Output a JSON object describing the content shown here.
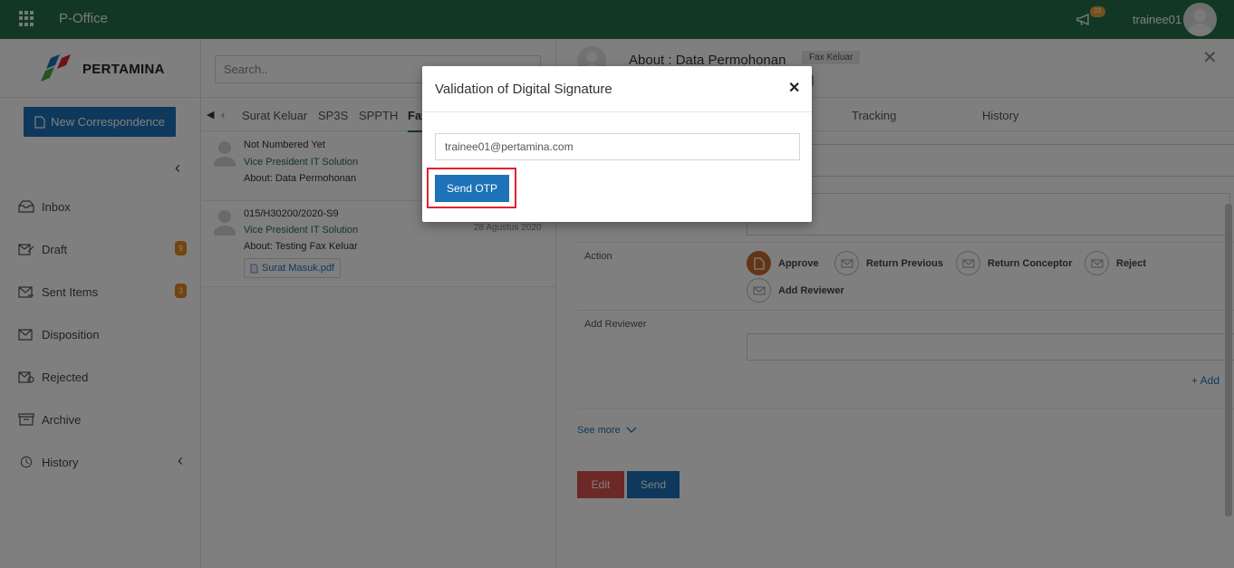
{
  "topbar": {
    "app_title": "P-Office",
    "notification_count": "23",
    "username": "trainee01"
  },
  "sidebar": {
    "logo_text": "PERTAMINA",
    "new_button": "New Correspondence",
    "items": [
      {
        "label": "Inbox",
        "icon": "inbox-icon",
        "badge": ""
      },
      {
        "label": "Draft",
        "icon": "draft-icon",
        "badge": "9"
      },
      {
        "label": "Sent Items",
        "icon": "sent-icon",
        "badge": "3"
      },
      {
        "label": "Disposition",
        "icon": "disposition-icon",
        "badge": ""
      },
      {
        "label": "Rejected",
        "icon": "rejected-icon",
        "badge": ""
      },
      {
        "label": "Archive",
        "icon": "archive-icon",
        "badge": ""
      },
      {
        "label": "History",
        "icon": "history-icon",
        "badge": ""
      }
    ]
  },
  "list": {
    "search_placeholder": "Search..",
    "tabs": [
      "Surat Keluar",
      "SP3S",
      "SPPTH",
      "Fax"
    ],
    "items": [
      {
        "number": "Not Numbered Yet",
        "from": "Vice President IT Solution",
        "about": "About: Data Permohonan",
        "date": ""
      },
      {
        "number": "015/H30200/2020-S9",
        "from": "Vice President IT Solution",
        "about": "About: Testing Fax Keluar",
        "date": "28 Agustus 2020",
        "attachment": "Surat Masuk.pdf"
      }
    ]
  },
  "detail": {
    "title": "About : Data Permohonan",
    "label": "Fax Keluar",
    "subtitle_fragment": "n ]",
    "tabs": [
      "Tracking",
      "History"
    ],
    "action_label": "Action",
    "actions": [
      "Approve",
      "Return Previous",
      "Return Conceptor",
      "Reject",
      "Add Reviewer"
    ],
    "add_reviewer_label": "Add Reviewer",
    "add_link": "+ Add",
    "see_more": "See more",
    "edit_button": "Edit",
    "send_button": "Send"
  },
  "modal": {
    "title": "Validation of Digital Signature",
    "email_value": "trainee01@pertamina.com",
    "send_otp": "Send OTP"
  },
  "colors": {
    "topbar": "#25704a",
    "primary": "#1d72b8",
    "danger": "#d9534f",
    "badge": "#e38b1a",
    "highlight": "#e3242b"
  }
}
